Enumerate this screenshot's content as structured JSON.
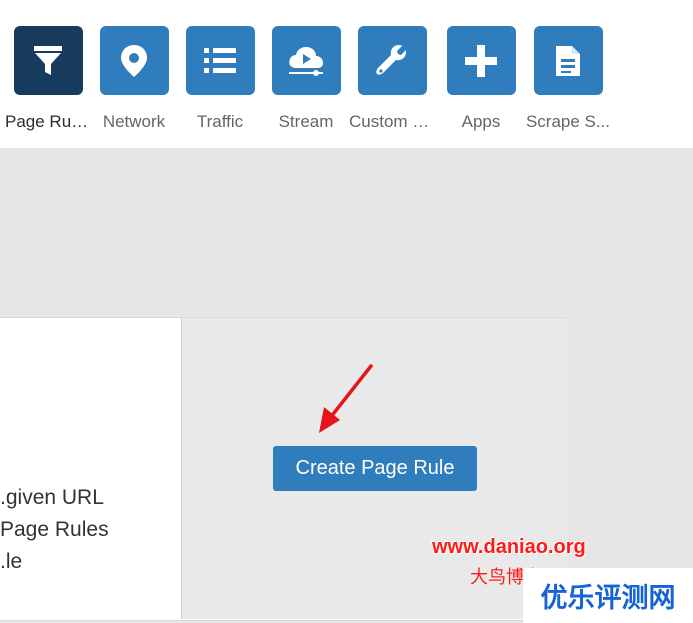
{
  "nav": {
    "items": [
      {
        "label": "Page Rules",
        "icon": "filter-icon"
      },
      {
        "label": "Network",
        "icon": "location-pin-icon"
      },
      {
        "label": "Traffic",
        "icon": "list-icon"
      },
      {
        "label": "Stream",
        "icon": "cloud-play-icon"
      },
      {
        "label": "Custom P...",
        "icon": "wrench-icon"
      },
      {
        "label": "Apps",
        "icon": "plus-icon"
      },
      {
        "label": "Scrape S...",
        "icon": "document-icon"
      }
    ]
  },
  "card": {
    "text_lines": [
      "given URL.",
      "Page Rules",
      "le."
    ]
  },
  "action": {
    "create_label": "Create Page Rule"
  },
  "watermark": {
    "url": "www.daniao.org",
    "cn_label": "大鸟博客",
    "box_label": "优乐评测网"
  },
  "colors": {
    "accent": "#2f7dbd",
    "active_tile": "#173b5c",
    "arrow": "#e8141b",
    "watermark_red": "#ff1a1a",
    "watermark_blue": "#1563d6"
  }
}
